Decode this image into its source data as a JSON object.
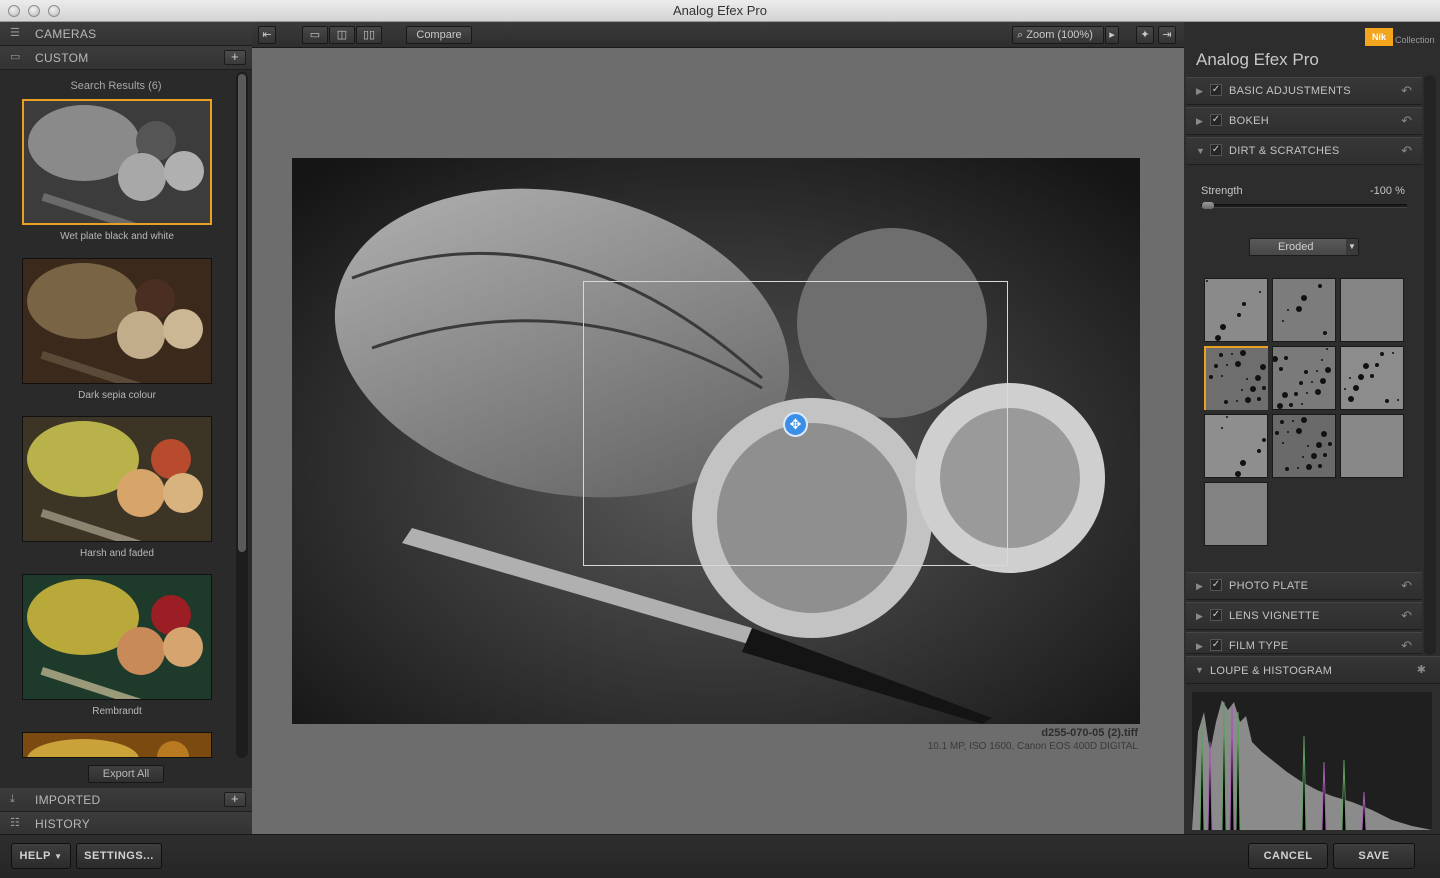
{
  "window": {
    "title": "Analog Efex Pro"
  },
  "left_panel": {
    "cameras_label": "CAMERAS",
    "custom_label": "CUSTOM",
    "search_results": "Search Results (6)",
    "presets": [
      {
        "label": "Wet plate black and white",
        "tone": "bw",
        "selected": true
      },
      {
        "label": "Dark sepia colour",
        "tone": "sepia",
        "selected": false
      },
      {
        "label": "Harsh and faded",
        "tone": "harsh",
        "selected": false
      },
      {
        "label": "Rembrandt",
        "tone": "rembrandt",
        "selected": false
      },
      {
        "label": "",
        "tone": "warm",
        "selected": false
      }
    ],
    "export_all": "Export All",
    "imported_label": "IMPORTED",
    "history_label": "HISTORY",
    "plus": "+"
  },
  "toolbar": {
    "compare_label": "Compare",
    "zoom_label": "Zoom (100%)"
  },
  "canvas": {
    "filename": "d255-070-05 (2).tiff",
    "fileinfo": "10.1 MP, ISO 1600, Canon EOS 400D DIGITAL"
  },
  "right_panel": {
    "brand": "Nik",
    "brand_suffix": "Collection",
    "app_title": "Analog Efex Pro",
    "sections": [
      {
        "label": "BASIC ADJUSTMENTS",
        "expanded": false,
        "checked": true
      },
      {
        "label": "BOKEH",
        "expanded": false,
        "checked": true
      },
      {
        "label": "DIRT & SCRATCHES",
        "expanded": true,
        "checked": true
      },
      {
        "label": "PHOTO PLATE",
        "expanded": false,
        "checked": true
      },
      {
        "label": "LENS VIGNETTE",
        "expanded": false,
        "checked": true
      },
      {
        "label": "FILM TYPE",
        "expanded": false,
        "checked": true
      }
    ],
    "strength_label": "Strength",
    "strength_value": "-100 %",
    "strength_fraction": 0.0,
    "dropdown_value": "Eroded",
    "textures_count": 10,
    "selected_texture": 3,
    "loupe_label": "LOUPE & HISTOGRAM"
  },
  "bottom": {
    "help": "HELP",
    "settings": "SETTINGS...",
    "cancel": "CANCEL",
    "save": "SAVE"
  },
  "colors": {
    "accent": "#e8a122",
    "handle": "#3b8fe6"
  }
}
